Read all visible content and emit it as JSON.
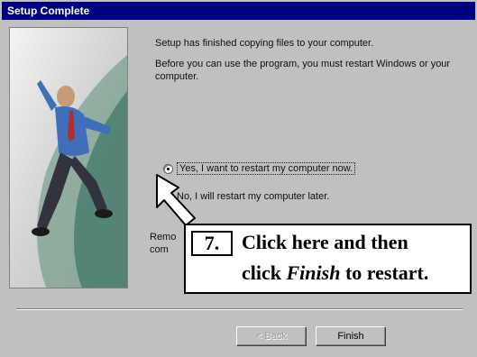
{
  "window": {
    "title": "Setup Complete"
  },
  "messages": {
    "finished": "Setup has finished copying files to your computer.",
    "restart_notice": "Before you can use the program, you must restart Windows or your computer."
  },
  "options": {
    "yes_label": "Yes, I want to restart my computer now.",
    "no_label": "No, I will restart my computer later.",
    "selected": "yes"
  },
  "remove_note": {
    "line1": "Remo",
    "line2": "com"
  },
  "buttons": {
    "back_label": "< Back",
    "finish_label": "Finish"
  },
  "callout": {
    "step": "7.",
    "line1": "Click here and then",
    "line2_pre": "click ",
    "line2_em": "Finish",
    "line2_post": " to restart."
  },
  "colors": {
    "titlebar": "#000080",
    "face": "#c0c0c0",
    "figure_shirt": "#3f6fb8"
  },
  "icons": {
    "pointer": "arrow-pointer-icon"
  }
}
